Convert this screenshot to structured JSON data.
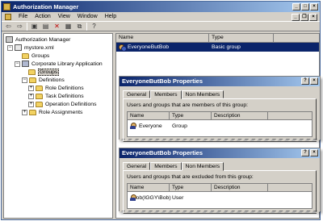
{
  "window": {
    "title": "Authorization Manager"
  },
  "menu": [
    "File",
    "Action",
    "View",
    "Window",
    "Help"
  ],
  "toolbar": [
    "back-icon",
    "forward-icon",
    "up-icon",
    "folder-icon",
    "delete-icon",
    "properties-icon",
    "export-icon",
    "help-icon"
  ],
  "tree": {
    "root": "Authorization Manager",
    "store": "mystore.xml",
    "store_groups": "Groups",
    "app": "Corporate Library Application",
    "app_groups": "Groups",
    "definitions": "Definitions",
    "role_definitions": "Role Definitions",
    "task_definitions": "Task Definitions",
    "operation_definitions": "Operation Definitions",
    "role_assignments": "Role Assignments"
  },
  "list": {
    "columns": [
      "Name",
      "Type"
    ],
    "rows": [
      {
        "name": "EveryoneButBob",
        "type": "Basic group"
      }
    ]
  },
  "dialog_members": {
    "title": "EveryoneButBob Properties",
    "tabs": [
      "General",
      "Members",
      "Non Members"
    ],
    "active_tab": "Members",
    "description": "Users and groups that are members of this group:",
    "columns": [
      "Name",
      "Type",
      "Description"
    ],
    "rows": [
      {
        "name": "Everyone",
        "type": "Group",
        "description": ""
      }
    ]
  },
  "dialog_nonmembers": {
    "title": "EveryoneButBob Properties",
    "tabs": [
      "General",
      "Members",
      "Non Members"
    ],
    "active_tab": "Non Members",
    "description": "Users and groups that are excluded from this group:",
    "columns": [
      "Name",
      "Type",
      "Description"
    ],
    "rows": [
      {
        "name": "Bob(IGGY\\Bob)",
        "type": "User",
        "description": ""
      }
    ]
  },
  "colors": {
    "titlebar": "#0a246a",
    "selection": "#0a246a",
    "face": "#d4d0c8"
  }
}
